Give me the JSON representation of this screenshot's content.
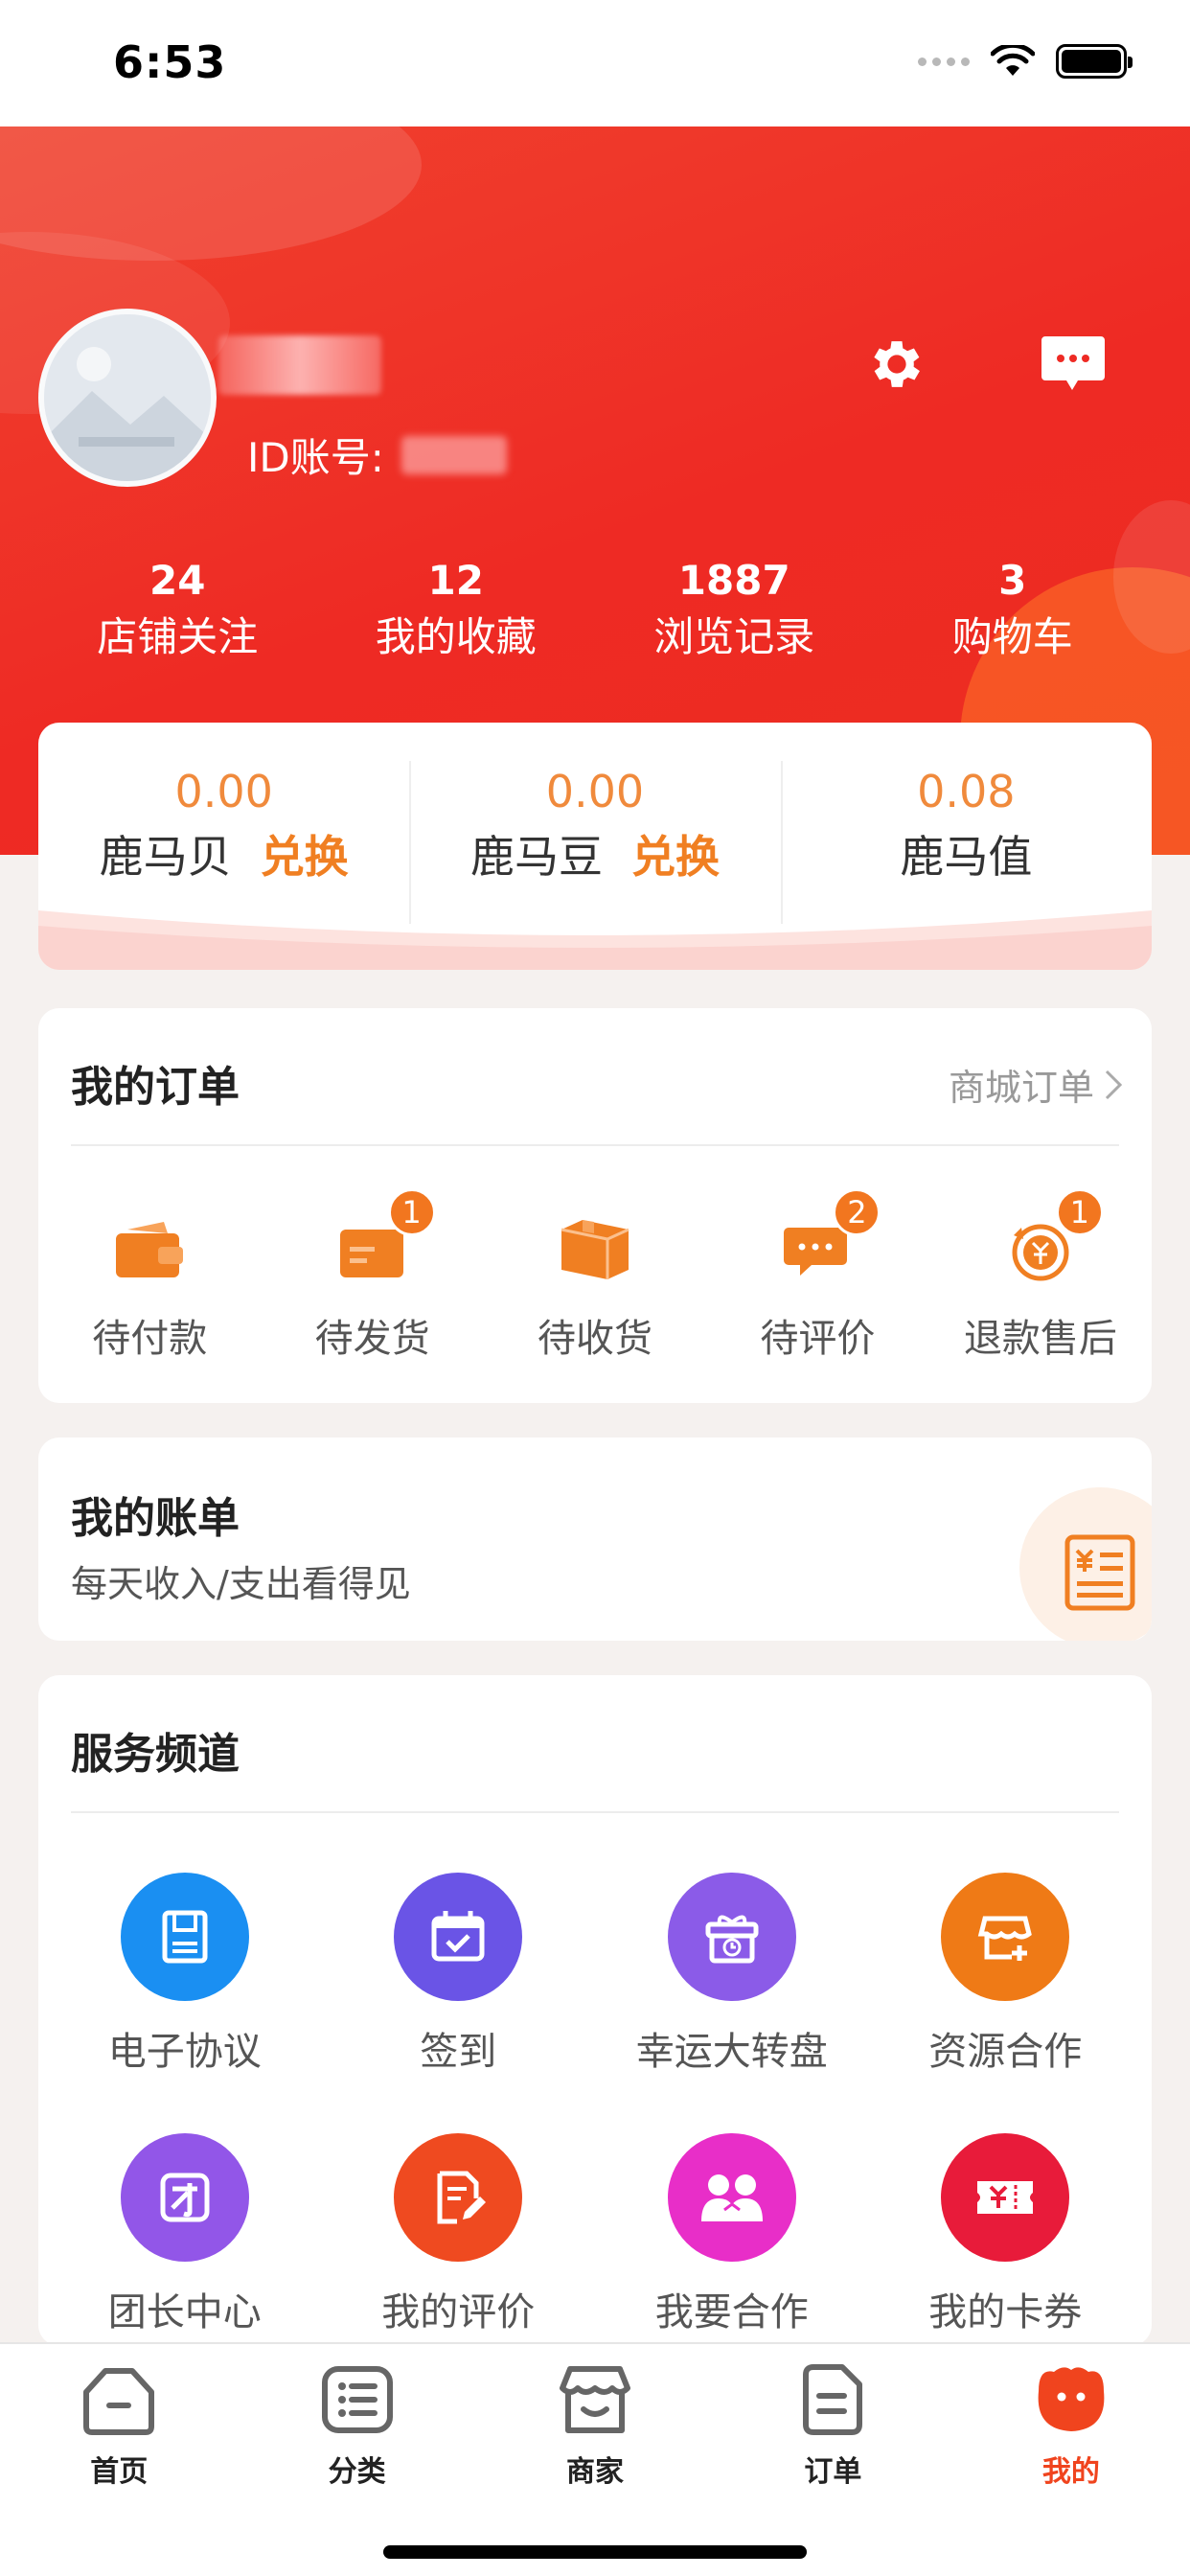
{
  "status_bar": {
    "time": "6:53"
  },
  "profile": {
    "id_label": "ID账号:"
  },
  "stats": [
    {
      "value": "24",
      "label": "店铺关注"
    },
    {
      "value": "12",
      "label": "我的收藏"
    },
    {
      "value": "1887",
      "label": "浏览记录"
    },
    {
      "value": "3",
      "label": "购物车"
    }
  ],
  "wallet": [
    {
      "value": "0.00",
      "label": "鹿马贝",
      "action": "兑换"
    },
    {
      "value": "0.00",
      "label": "鹿马豆",
      "action": "兑换"
    },
    {
      "value": "0.08",
      "label": "鹿马值"
    }
  ],
  "orders": {
    "title": "我的订单",
    "more": "商城订单",
    "items": [
      {
        "label": "待付款",
        "icon": "wallet-icon"
      },
      {
        "label": "待发货",
        "icon": "shipping-icon",
        "badge": "1"
      },
      {
        "label": "待收货",
        "icon": "package-icon"
      },
      {
        "label": "待评价",
        "icon": "comment-icon",
        "badge": "2"
      },
      {
        "label": "退款售后",
        "icon": "refund-icon",
        "badge": "1"
      }
    ]
  },
  "bill": {
    "title": "我的账单",
    "subtitle": "每天收入/支出看得见",
    "icon": "bill-icon"
  },
  "services": {
    "title": "服务频道",
    "items": [
      {
        "label": "电子协议",
        "icon": "document-icon",
        "color": "#1a8ff2"
      },
      {
        "label": "签到",
        "icon": "calendar-check-icon",
        "color": "#6a54e6"
      },
      {
        "label": "幸运大转盘",
        "icon": "gift-box-icon",
        "color": "#8b5be8"
      },
      {
        "label": "资源合作",
        "icon": "store-plus-icon",
        "color": "#ef7a16"
      },
      {
        "label": "团长中心",
        "icon": "team-leader-icon",
        "color": "#9256e8"
      },
      {
        "label": "我的评价",
        "icon": "pen-note-icon",
        "color": "#ef4a20"
      },
      {
        "label": "我要合作",
        "icon": "partners-icon",
        "color": "#e82ec8"
      },
      {
        "label": "我的卡券",
        "icon": "coupon-icon",
        "color": "#e81b3a"
      }
    ]
  },
  "tabs": [
    {
      "label": "首页",
      "icon": "home-icon"
    },
    {
      "label": "分类",
      "icon": "list-icon"
    },
    {
      "label": "商家",
      "icon": "shop-icon"
    },
    {
      "label": "订单",
      "icon": "order-doc-icon"
    },
    {
      "label": "我的",
      "icon": "mine-face-icon",
      "active": true
    }
  ],
  "colors": {
    "primary_red": "#ee2a24",
    "accent_orange": "#f07f22"
  }
}
